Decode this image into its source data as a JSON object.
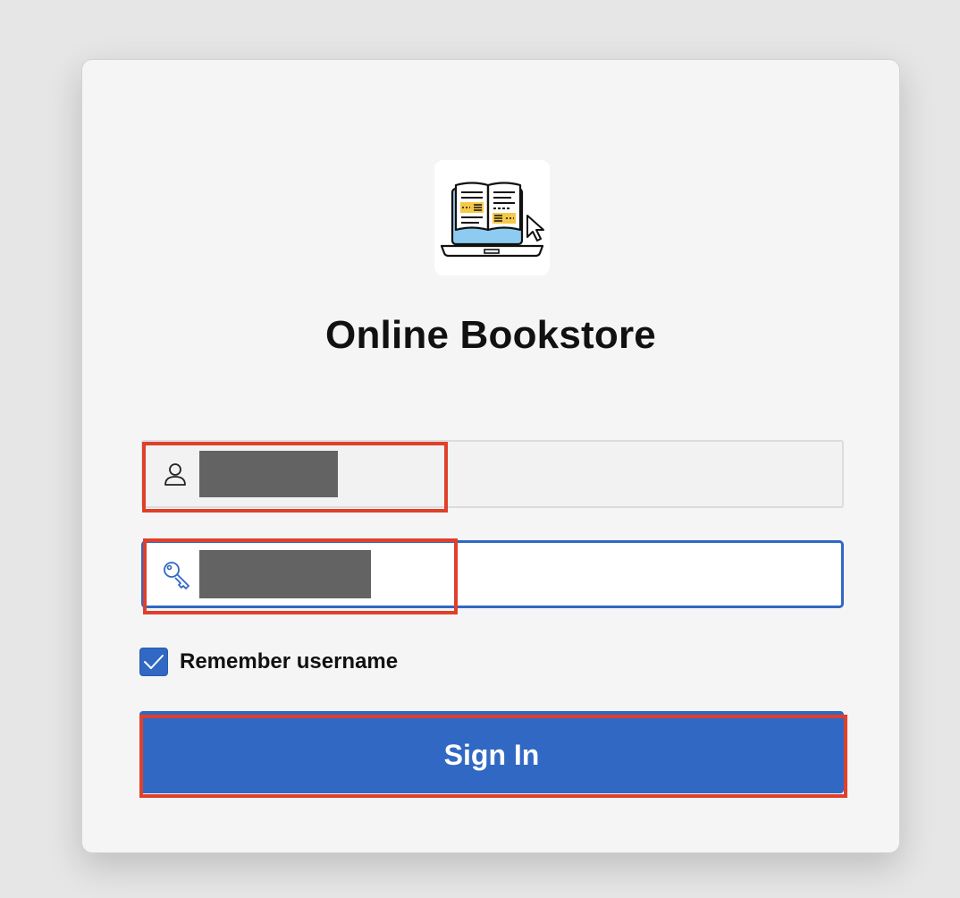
{
  "app": {
    "title": "Online Bookstore",
    "logo_icon": "open-book-on-laptop-icon"
  },
  "form": {
    "username": {
      "icon": "user-icon",
      "value_masked": true
    },
    "password": {
      "icon": "key-icon",
      "value_masked": true,
      "focused": true
    },
    "remember_username": {
      "label": "Remember username",
      "checked": true
    },
    "sign_in_label": "Sign In"
  },
  "colors": {
    "accent": "#3068c4",
    "highlight": "#e0402a",
    "mask": "#636363",
    "card": "#f5f5f5",
    "background": "#e6e6e6"
  }
}
